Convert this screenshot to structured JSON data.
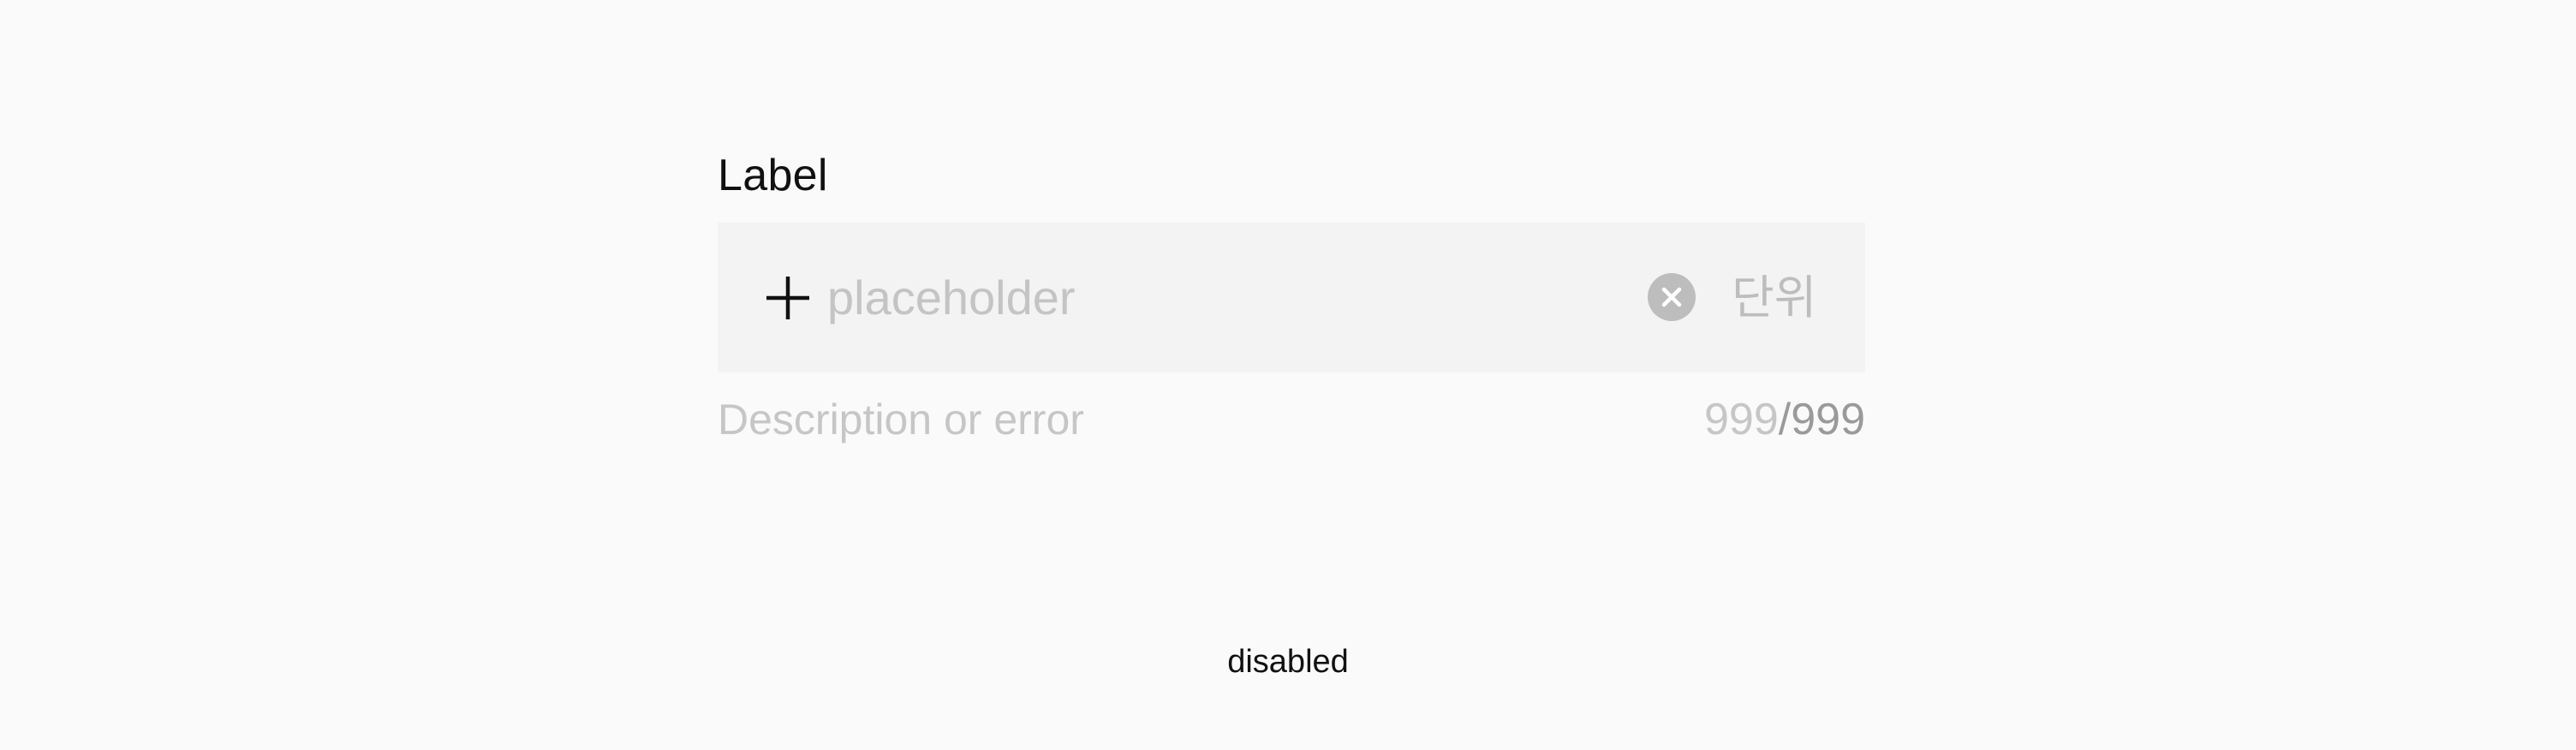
{
  "field": {
    "label": "Label",
    "input": {
      "placeholder": "placeholder",
      "value": "",
      "leading_icon": "plus-icon",
      "clear_icon": "clear-circle-icon",
      "unit": "단위"
    },
    "description": "Description or error",
    "counter": {
      "current": "999",
      "separator": "/",
      "max": "999"
    }
  },
  "state_caption": "disabled",
  "colors": {
    "background": "#fafafa",
    "input_background": "#f3f3f3",
    "disabled_text": "#c4c4c4",
    "icon_dark": "#111111",
    "clear_icon_fill": "#bdbdbd"
  }
}
